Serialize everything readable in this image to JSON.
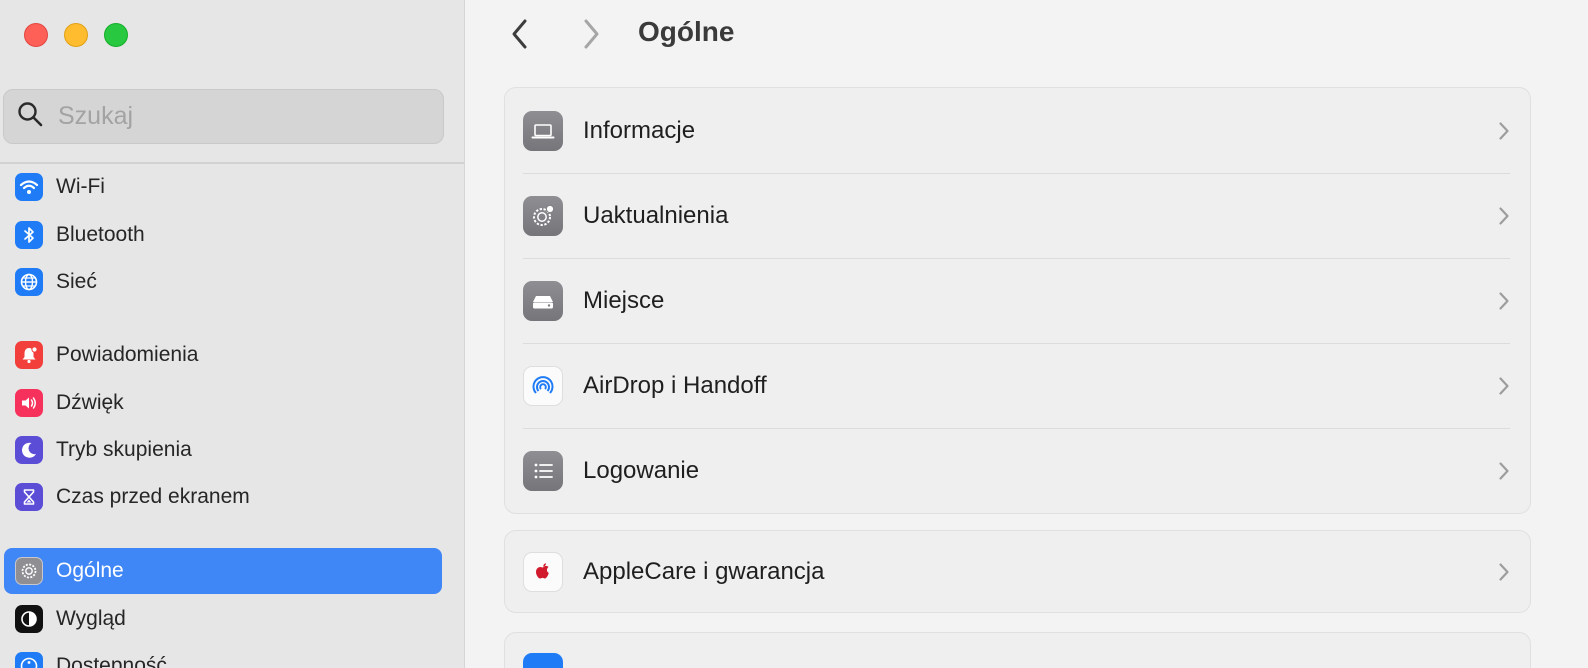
{
  "window": {
    "title": "Ogólne"
  },
  "search": {
    "placeholder": "Szukaj"
  },
  "sidebar": {
    "items": [
      {
        "label": "Wi-Fi",
        "icon": "wifi-icon",
        "color": "#1f7cf6"
      },
      {
        "label": "Bluetooth",
        "icon": "bluetooth-icon",
        "color": "#1f7cf6"
      },
      {
        "label": "Sieć",
        "icon": "globe-icon",
        "color": "#1f7cf6"
      },
      {
        "label": "Powiadomienia",
        "icon": "bell-icon",
        "color": "#f23f3b"
      },
      {
        "label": "Dźwięk",
        "icon": "speaker-icon",
        "color": "#f5315c"
      },
      {
        "label": "Tryb skupienia",
        "icon": "moon-icon",
        "color": "#5b4dd6"
      },
      {
        "label": "Czas przed ekranem",
        "icon": "hourglass-icon",
        "color": "#5b4dd6"
      },
      {
        "label": "Ogólne",
        "icon": "gear-icon",
        "color": "#8e8e93",
        "active": true
      },
      {
        "label": "Wygląd",
        "icon": "appearance-icon",
        "color": "#111111"
      },
      {
        "label": "Dostępność",
        "icon": "accessibility-icon",
        "color": "#1f7cf6"
      }
    ]
  },
  "main": {
    "nav": {
      "back_icon": "chevron-left-icon",
      "forward_icon": "chevron-right-icon"
    },
    "groups": [
      {
        "rows": [
          {
            "label": "Informacje",
            "icon": "laptop-icon"
          },
          {
            "label": "Uaktualnienia",
            "icon": "software-update-gear-icon"
          },
          {
            "label": "Miejsce",
            "icon": "storage-drive-icon"
          },
          {
            "label": "AirDrop i Handoff",
            "icon": "airdrop-icon"
          },
          {
            "label": "Logowanie",
            "icon": "list-icon"
          }
        ]
      },
      {
        "rows": [
          {
            "label": "AppleCare i gwarancja",
            "icon": "apple-logo-icon",
            "color": "#d11b2d"
          }
        ]
      }
    ]
  },
  "colors": {
    "accent": "#3f86f7",
    "sidebar_bg": "#e6e6e6",
    "main_bg": "#f3f3f3"
  }
}
